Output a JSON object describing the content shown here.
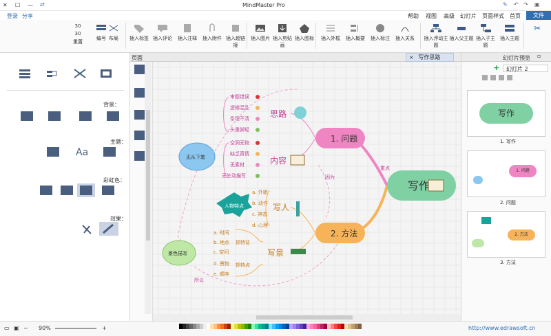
{
  "window": {
    "title": "MindMaster Pro",
    "help": "帮助",
    "close": "✕",
    "maximize": "☐",
    "minimize": "—"
  },
  "menu": {
    "items": [
      "文件",
      "首页",
      "页面样式",
      "幻灯片",
      "高级",
      "视图",
      "帮助"
    ],
    "right_items": [
      "登录",
      "分享"
    ]
  },
  "ribbon": {
    "left_group": [
      "插入主题",
      "插入子主题",
      "插入父主题",
      "插入浮动主题"
    ],
    "buttons": [
      "插入关系",
      "插入标注",
      "插入概要",
      "插入外框",
      "插入图标",
      "插入剪贴画",
      "插入图片",
      "插入超链接",
      "插入附件",
      "插入注释",
      "插入评论",
      "插入标签"
    ],
    "right_group": {
      "layout": "布局",
      "number": "编号",
      "reset": "重置",
      "sep1": "30",
      "sep2": "30"
    }
  },
  "left_panel": {
    "background_label": "背景：",
    "theme_label": "主题：",
    "rainbow_label": "彩虹色：",
    "effect_label": "效果："
  },
  "tab": {
    "label": "写作思路"
  },
  "canvas_strip_label": "页面",
  "right_panel": {
    "title": "幻灯片预览",
    "dropdown": "幻灯片 2",
    "slides": [
      {
        "caption": "1. 写作",
        "central": "写作"
      },
      {
        "caption": "2. 问题",
        "central": "1. 问题"
      },
      {
        "caption": "3. 方法",
        "central": "2. 方法"
      }
    ]
  },
  "mindmap": {
    "central": "写作",
    "branch1": "1. 问题",
    "branch2": "2. 方法",
    "b1_sub1": "思路",
    "b1_sub2": "内容",
    "b1_sub1_items": [
      "审题错误",
      "逻辑混乱",
      "条理不清",
      "头重脚轻"
    ],
    "b1_sub2_items": [
      "空洞无物",
      "缺乏真情",
      "无素材",
      "无生动描写"
    ],
    "b2_sub1": "写人",
    "b2_sub2": "写景",
    "b2_sub1_items": [
      "a. 外貌",
      "b. 动作",
      "c. 神态",
      "d. 心理"
    ],
    "b2_sub2_items": [
      "a. 时间",
      "b. 地点",
      "c. 空间",
      "d. 景物",
      "e. 顺序"
    ],
    "b2_sub2_mid": [
      "抓特征",
      "抓特点"
    ],
    "callout_cloud": "无从下笔",
    "callout_star": "人物特点",
    "callout_cloud2": "景色描写",
    "rel1": "因为",
    "rel2": "重点",
    "rel3": "所以"
  },
  "status": {
    "zoom": "90%",
    "url": "http://www.edrawsoft.cn"
  },
  "colors": {
    "central": "#7fd1a3",
    "branch1": "#ef86c3",
    "branch2": "#f7b35a",
    "accent": "#2f6fb3"
  }
}
